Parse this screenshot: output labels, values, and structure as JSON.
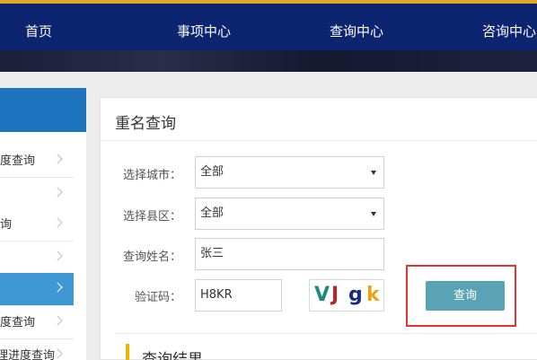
{
  "nav": {
    "items": [
      {
        "label": "首页"
      },
      {
        "label": "事项中心"
      },
      {
        "label": "查询中心"
      },
      {
        "label": "咨询中心"
      }
    ]
  },
  "sidebar": {
    "items": [
      {
        "label": "进度查询",
        "active": false
      },
      {
        "label": "",
        "active": false
      },
      {
        "label": "询",
        "active": false
      },
      {
        "label": "",
        "active": false
      },
      {
        "label": "",
        "active": true
      },
      {
        "label": "度查询",
        "active": false
      },
      {
        "label": "理进度查询",
        "active": false
      }
    ]
  },
  "panel": {
    "title": "重名查询",
    "city_label": "选择城市：",
    "city_value": "全部",
    "district_label": "选择县区：",
    "district_value": "全部",
    "name_label": "查询姓名：",
    "name_value": "张三",
    "captcha_label": "验证码：",
    "captcha_value": "H8KR",
    "captcha_image_chars": [
      "V",
      "J",
      "g",
      "k"
    ],
    "captcha_colors": [
      "#1b8c7c",
      "#b0282c",
      "#1a2a8a",
      "#e8a317"
    ],
    "query_button": "查询",
    "result_title": "查询结果"
  },
  "colors": {
    "nav_bg": "#0d2470",
    "nav_border": "#e0a82a",
    "sidebar_head": "#1f74bf",
    "sidebar_active": "#3f97d3",
    "button": "#5aa3b5",
    "highlight": "#e53333",
    "result_accent": "#f0b400"
  }
}
